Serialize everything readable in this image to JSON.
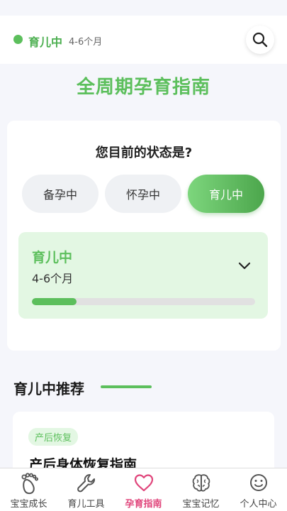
{
  "header": {
    "status": "育儿中",
    "stage": "4-6个月"
  },
  "page_title": "全周期孕育指南",
  "state_card": {
    "question": "您目前的状态是?",
    "options": [
      {
        "label": "备孕中",
        "selected": false
      },
      {
        "label": "怀孕中",
        "selected": false
      },
      {
        "label": "育儿中",
        "selected": true
      }
    ],
    "current": {
      "name": "育儿中",
      "range": "4-6个月",
      "progress_percent": 20
    }
  },
  "recommend": {
    "title": "育儿中推荐",
    "items": [
      {
        "tag": "产后恢复",
        "title": "产后身体恢复指南"
      }
    ]
  },
  "tabbar": {
    "tabs": [
      {
        "label": "宝宝成长",
        "icon": "footprint-icon",
        "active": false
      },
      {
        "label": "育儿工具",
        "icon": "wrench-icon",
        "active": false
      },
      {
        "label": "孕育指南",
        "icon": "heart-icon",
        "active": true
      },
      {
        "label": "宝宝记忆",
        "icon": "brain-icon",
        "active": false
      },
      {
        "label": "个人中心",
        "icon": "smiley-icon",
        "active": false
      }
    ]
  },
  "colors": {
    "accent_green": "#5cbf5c",
    "active_tab": "#e0457b"
  }
}
